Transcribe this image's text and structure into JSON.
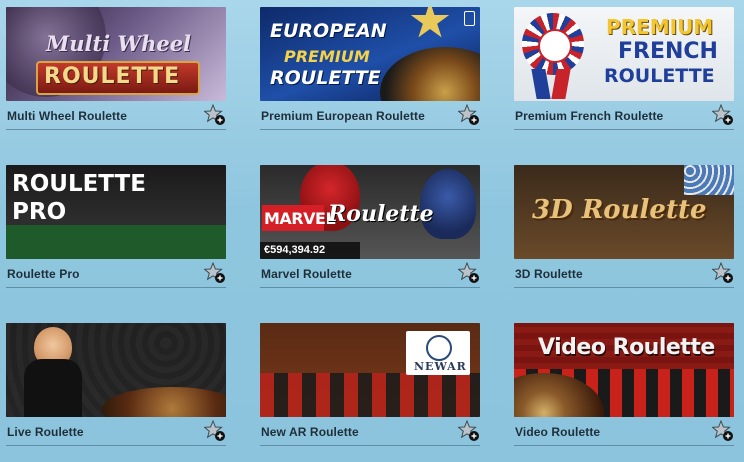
{
  "games": [
    {
      "name": "Multi Wheel Roulette",
      "art_line1": "Multi Wheel",
      "art_line2": "ROULETTE"
    },
    {
      "name": "Premium European Roulette",
      "art_line1": "EUROPEAN",
      "art_line2": "PREMIUM",
      "art_line3": "ROULETTE"
    },
    {
      "name": "Premium French Roulette",
      "art_line1": "PREMIUM",
      "art_line2": "FRENCH",
      "art_line3": "ROULETTE"
    },
    {
      "name": "Roulette Pro",
      "art_line1": "ROULETTE",
      "art_line2": "PRO"
    },
    {
      "name": "Marvel Roulette",
      "art_line1": "MARVEL",
      "art_line2": "Roulette",
      "jackpot": "€594,394.92"
    },
    {
      "name": "3D Roulette",
      "art_line1": "3D Roulette"
    },
    {
      "name": "Live Roulette"
    },
    {
      "name": "New AR Roulette",
      "art_line1": "NEWAR"
    },
    {
      "name": "Video Roulette",
      "art_line1": "Video Roulette"
    }
  ],
  "colors": {
    "page_bg": "#8fc6df",
    "title_text": "#1f2f3a",
    "divider": "#5f8ea5"
  },
  "icons": {
    "favorite": "star-plus-icon"
  }
}
